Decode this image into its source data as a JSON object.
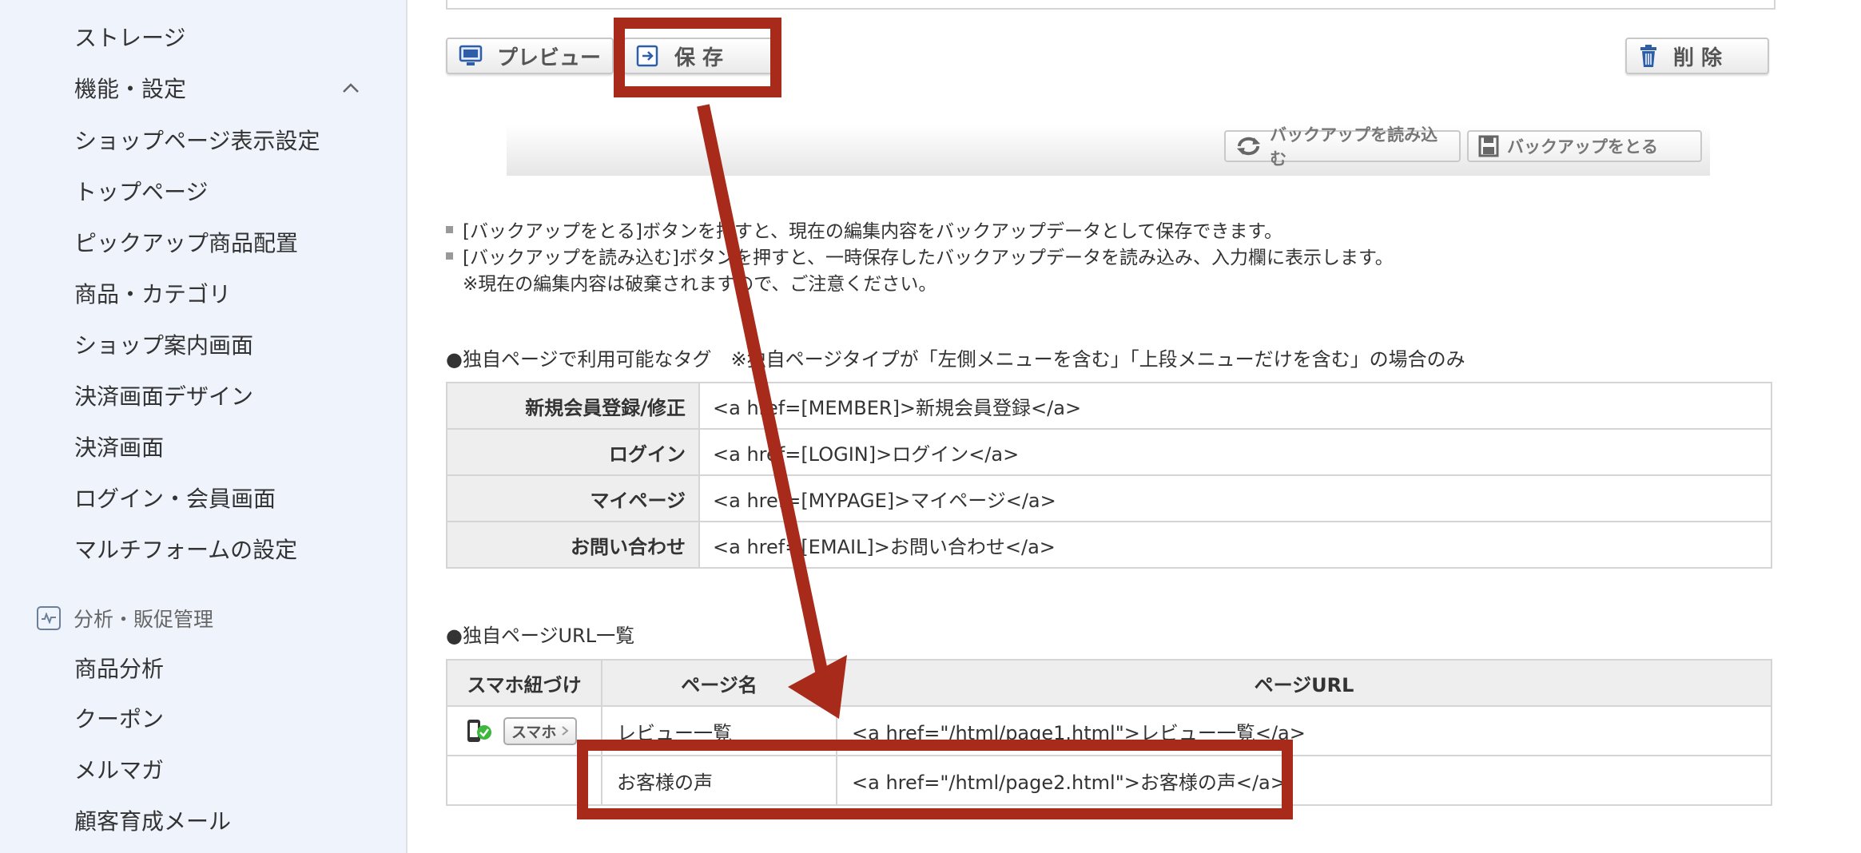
{
  "sidebar": {
    "items": [
      "ストレージ",
      "機能・設定",
      "ショップページ表示設定",
      "トップページ",
      "ピックアップ商品配置",
      "商品・カテゴリ",
      "ショップ案内画面",
      "決済画面デザイン",
      "決済画面",
      "ログイン・会員画面",
      "マルチフォームの設定"
    ],
    "section_title": "分析・販促管理",
    "section_items": [
      "商品分析",
      "クーポン",
      "メルマガ",
      "顧客育成メール"
    ]
  },
  "toolbar": {
    "preview_label": "プレビュー",
    "save_label": "保 存",
    "delete_label": "削 除"
  },
  "backup": {
    "load_label": "バックアップを読み込む",
    "take_label": "バックアップをとる"
  },
  "notes": [
    "[バックアップをとる]ボタンを押すと、現在の編集内容をバックアップデータとして保存できます。",
    "[バックアップを読み込む]ボタンを押すと、一時保存したバックアップデータを読み込み、入力欄に表示します。",
    "※現在の編集内容は破棄されますので、ご注意ください。"
  ],
  "tags_section": {
    "heading": "●独自ページで利用可能なタグ　※独自ページタイプが「左側メニューを含む」「上段メニューだけを含む」の場合のみ",
    "rows": [
      {
        "label": "新規会員登録/修正",
        "value": "<a href=[MEMBER]>新規会員登録</a>"
      },
      {
        "label": "ログイン",
        "value": "<a href=[LOGIN]>ログイン</a>"
      },
      {
        "label": "マイページ",
        "value": "<a href=[MYPAGE]>マイページ</a>"
      },
      {
        "label": "お問い合わせ",
        "value": "<a href=[EMAIL]>お問い合わせ</a>"
      }
    ]
  },
  "url_section": {
    "heading": "●独自ページURL一覧",
    "headers": [
      "スマホ紐づけ",
      "ページ名",
      "ページURL"
    ],
    "smartphone_tag": "スマホ",
    "rows": [
      {
        "name": "レビュー一覧",
        "url": "<a href=\"/html/page1.html\">レビュー一覧</a>"
      },
      {
        "name": "お客様の声",
        "url": "<a href=\"/html/page2.html\">お客様の声</a>"
      }
    ]
  },
  "colors": {
    "annotation": "#a72a1a",
    "sidebar_bg": "#eef3fc",
    "header_bg": "#eeeeee"
  }
}
